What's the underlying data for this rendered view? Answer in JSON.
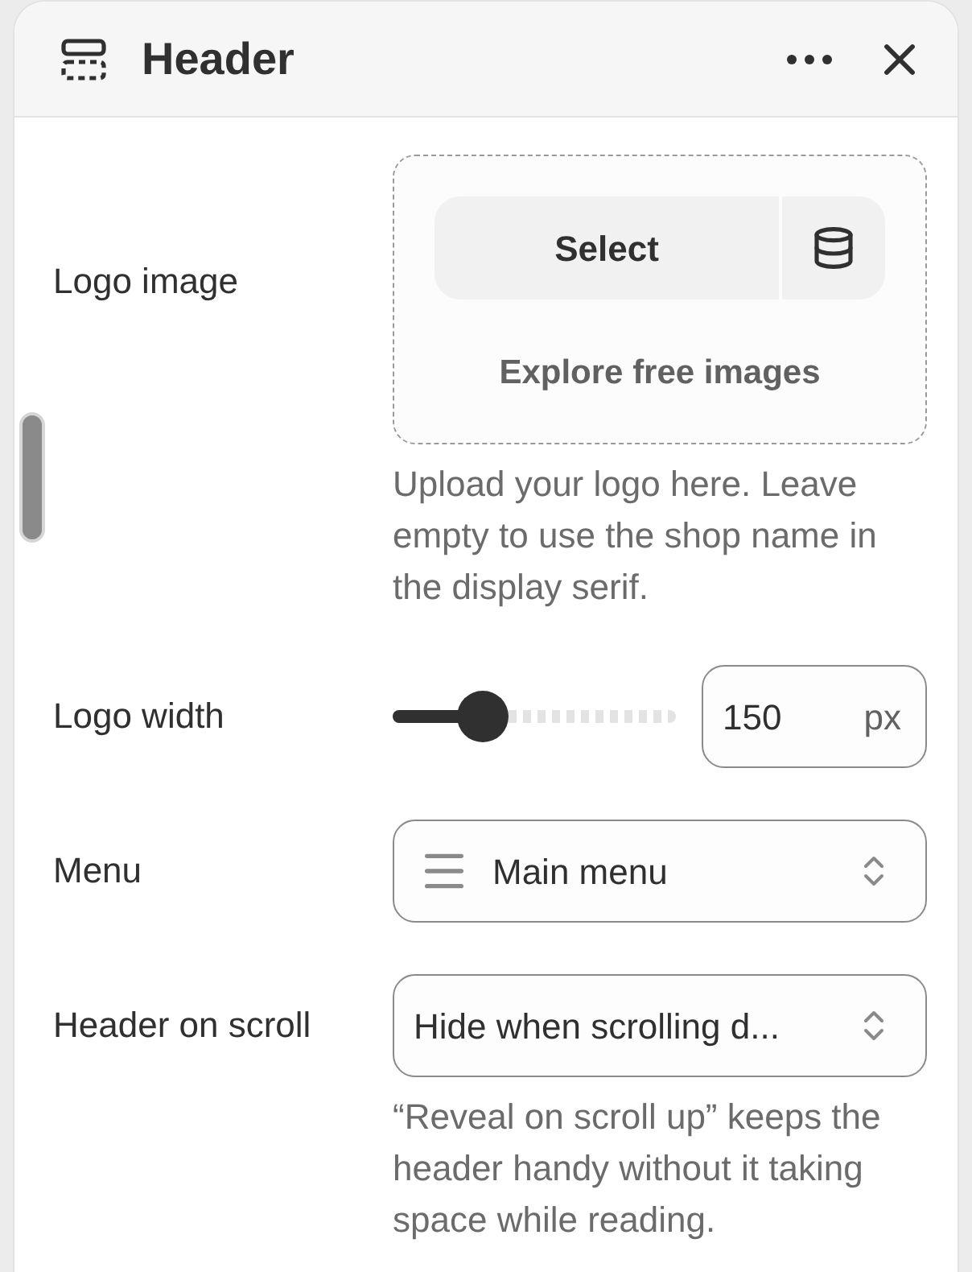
{
  "panel": {
    "title": "Header"
  },
  "fields": [
    {
      "kind": "image",
      "label": "Logo image",
      "button": "Select",
      "link": "Explore free images",
      "help": "Upload your logo here. Leave empty to use the shop name in the display serif."
    },
    {
      "kind": "range",
      "label": "Logo width",
      "level": 0.32,
      "value": "150",
      "unit": "px"
    },
    {
      "kind": "menu",
      "label": "Menu",
      "value": "Main menu"
    },
    {
      "kind": "select",
      "label": "Header on scroll",
      "value": "Hide when scrolling d...",
      "help": "“Reveal on scroll up” keeps the header handy without it taking space while reading."
    }
  ]
}
